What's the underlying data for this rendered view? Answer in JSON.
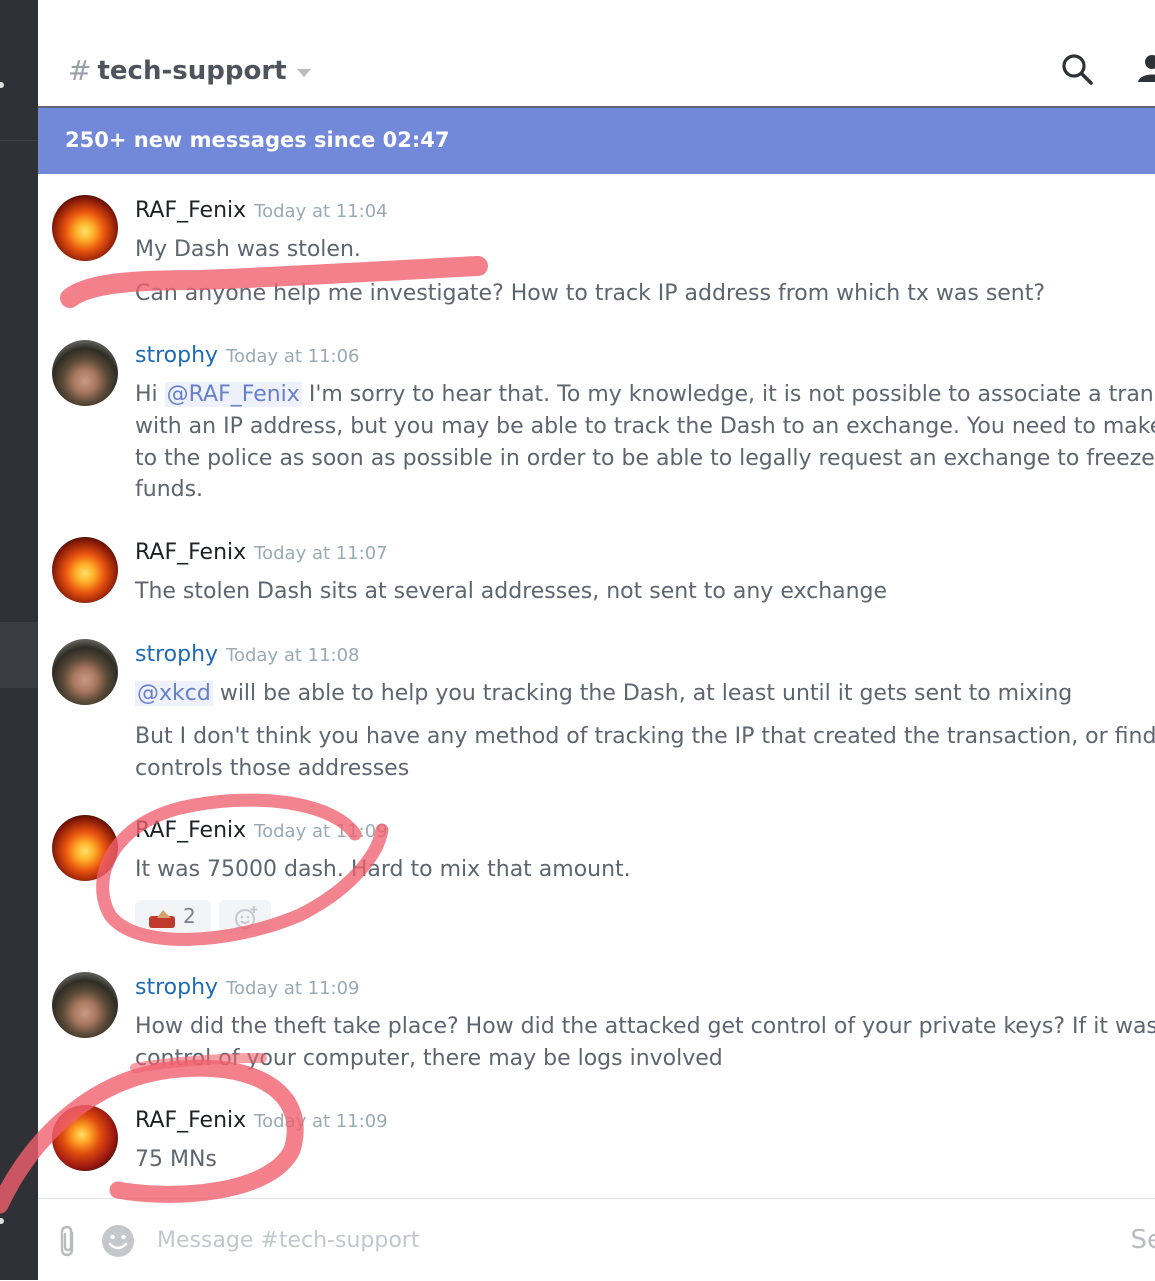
{
  "header": {
    "hash_symbol": "#",
    "channel_name": "tech-support",
    "search_icon": "search-icon",
    "members_icon": "members-icon"
  },
  "banner": {
    "text": "250+ new messages since 02:47"
  },
  "messages": [
    {
      "author": "RAF_Fenix",
      "timestamp": "Today at 11:04",
      "avatar": "phoenix-avatar",
      "lines": [
        "My Dash was stolen.",
        "Can anyone help me investigate? How to track IP address from which tx was sent?"
      ]
    },
    {
      "author": "strophy",
      "timestamp": "Today at 11:06",
      "avatar": "person-avatar",
      "mention": "@RAF_Fenix",
      "lines": [
        "Hi",
        "I'm sorry to hear that. To my knowledge, it is not possible to associate a transaction",
        "with an IP address, but you may be able to track the Dash to an exchange. You need to make a report",
        "to the police as soon as possible in order to be able to legally request an exchange to freeze your",
        "funds."
      ]
    },
    {
      "author": "RAF_Fenix",
      "timestamp": "Today at 11:07",
      "avatar": "phoenix-avatar",
      "lines": [
        "The stolen Dash sits at several addresses, not sent to any exchange"
      ]
    },
    {
      "author": "strophy",
      "timestamp": "Today at 11:08",
      "avatar": "person-avatar",
      "mention": "@xkcd",
      "lines": [
        "will be able to help you tracking the Dash, at least until it gets sent to mixing",
        "But I don't think you have any method of tracking the IP that created the transaction, or finding who",
        "controls those addresses"
      ]
    },
    {
      "author": "RAF_Fenix",
      "timestamp": "Today at 11:09",
      "avatar": "phoenix-avatar",
      "lines": [
        "It was 75000 dash. Hard to mix that amount."
      ],
      "reaction": {
        "emoji": "money-bag-emoji",
        "count": "2",
        "add_icon": "add-reaction-icon"
      }
    },
    {
      "author": "strophy",
      "timestamp": "Today at 11:09",
      "avatar": "person-avatar",
      "lines": [
        "How did the theft take place? How did the attacked get control of your private keys? If it was remote",
        "control of your computer, there may be logs involved"
      ]
    },
    {
      "author": "RAF_Fenix",
      "timestamp": "Today at 11:09",
      "avatar": "phoenix-avatar",
      "lines": [
        "75 MNs"
      ]
    }
  ],
  "composer": {
    "placeholder": "Message #tech-support",
    "send_label": "Se",
    "attach_icon": "paperclip-icon",
    "emoji_icon": "emoji-icon"
  },
  "colors": {
    "banner": "#7289da",
    "mention": "#6680c9",
    "strophy_name": "#1e6ab4",
    "highlight_marker": "#f0606e",
    "sidebar": "#2f3136"
  }
}
